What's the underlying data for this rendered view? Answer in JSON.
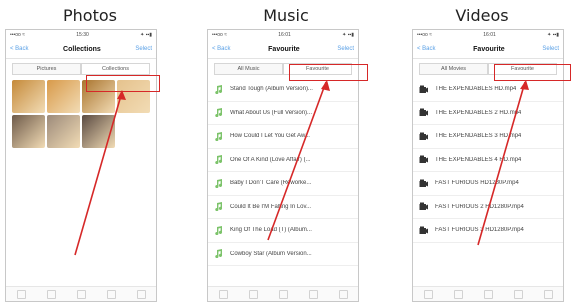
{
  "headings": [
    "Photos",
    "Music",
    "Videos"
  ],
  "colors": {
    "highlight": "#d62828",
    "accent": "#5aa0e6"
  },
  "photos": {
    "status": {
      "carrier": "•••oo ≈",
      "time": "15:30",
      "battery": "✦ ▪▪▮"
    },
    "nav": {
      "back": "< Back",
      "title": "Collections",
      "select": "Select"
    },
    "tabs": [
      "Pictures",
      "Collections"
    ],
    "active_tab": 1,
    "thumbs": [
      "#c58a3a",
      "#d89a4a",
      "#a9742e",
      "#e5c28d",
      "#6e5a4a",
      "#9c8a7a",
      "#5a4a42"
    ]
  },
  "music": {
    "status": {
      "carrier": "•••oo ≈",
      "time": "16:01",
      "battery": "✦ ▪▪▮"
    },
    "nav": {
      "back": "< Back",
      "title": "Favourite",
      "select": "Select"
    },
    "tabs": [
      "All Music",
      "Favourite"
    ],
    "active_tab": 1,
    "items": [
      "Stand Tough (Album Version)...",
      "What About Us (Full Version)...",
      "How Could I Let You Get Aw...",
      "One Of A Kind (Love Affair) (...",
      "Baby I Don'T Care (Reworke...",
      "Could It Be I'M Falling In Lov...",
      "King Of The Load (T) (Album...",
      "Cowboy Star (Album Version..."
    ]
  },
  "videos": {
    "status": {
      "carrier": "•••oo ≈",
      "time": "16:01",
      "battery": "✦ ▪▪▮"
    },
    "nav": {
      "back": "< Back",
      "title": "Favourite",
      "select": "Select"
    },
    "tabs": [
      "All Movies",
      "Favourite"
    ],
    "active_tab": 1,
    "items": [
      "THE EXPENDABLES HD.mp4",
      "THE EXPENDABLES 2 HD.mp4",
      "THE EXPENDABLES 3 HD.mp4",
      "THE EXPENDABLES 4 HD.mp4",
      "FAST FURIOUS HD1280P.mp4",
      "FAST FURIOUS 2 HD1280P.mp4",
      "FAST FURIOUS 3 HD1280P.mp4"
    ]
  }
}
